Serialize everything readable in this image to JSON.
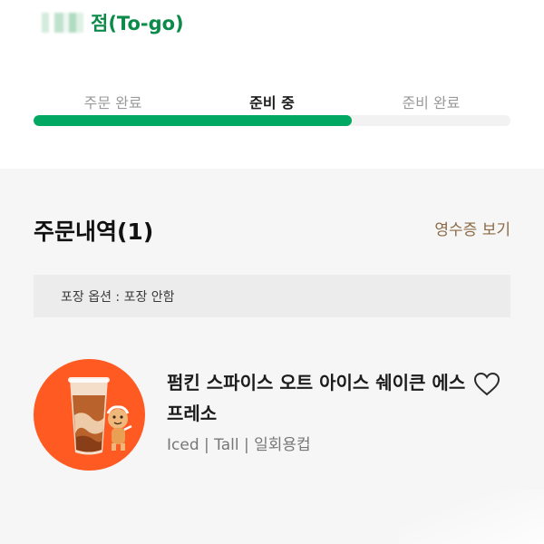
{
  "header": {
    "store_suffix": "점(To-go)"
  },
  "progress": {
    "steps": [
      "주문 완료",
      "준비 중",
      "준비 완료"
    ],
    "active_step_index": 1,
    "fill_fraction": 0.667,
    "fill_color": "#00a862"
  },
  "order": {
    "title": "주문내역(1)",
    "receipt_link": "영수증 보기",
    "packaging_option": "포장 옵션 : 포장 안함",
    "items": [
      {
        "name": "펌킨 스파이스 오트 아이스 쉐이큰 에스프레소",
        "options": "Iced | Tall | 일회용컵",
        "thumbnail_icon": "iced-latte-with-mascot-icon",
        "favorite_icon": "heart-outline-icon"
      }
    ]
  },
  "colors": {
    "brand_green": "#0b8a4a",
    "receipt_brown": "#8c6a46",
    "thumb_orange": "#ff5a22"
  }
}
